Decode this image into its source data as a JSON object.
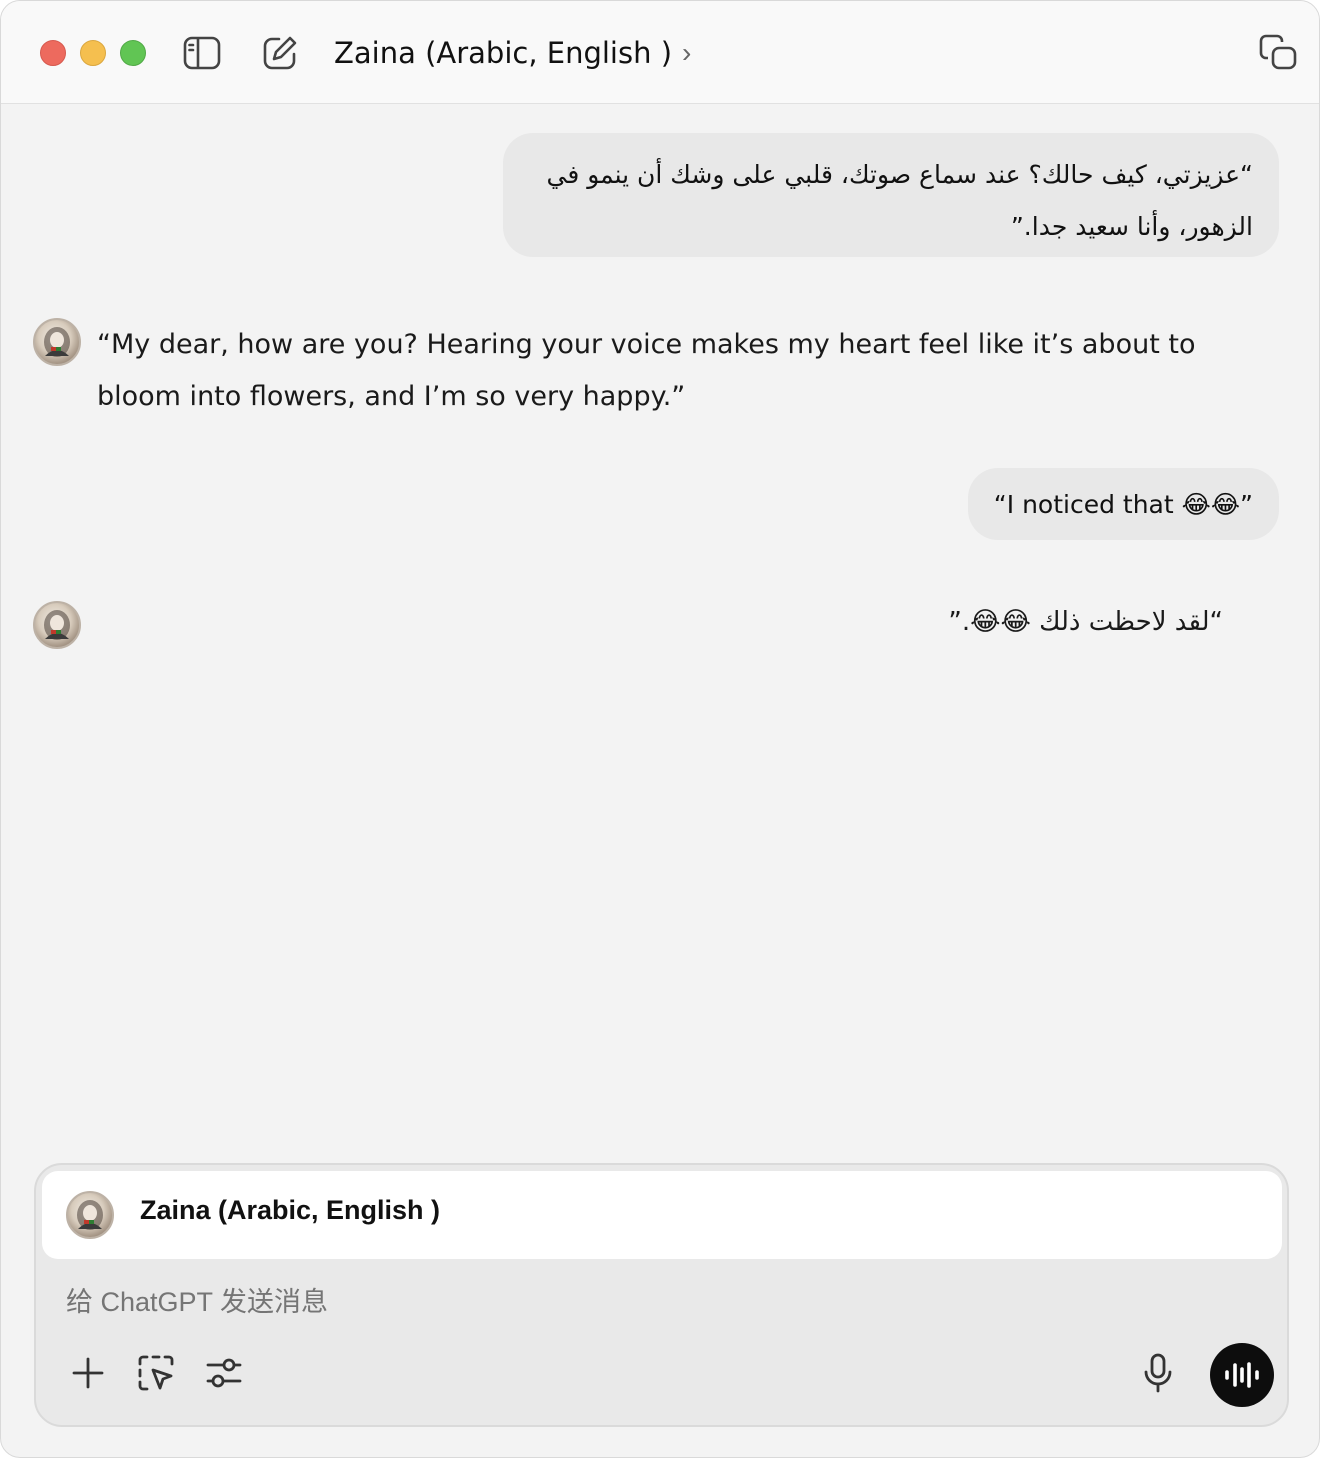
{
  "titlebar": {
    "title": "Zaina (Arabic, English )",
    "chevron": "›",
    "icons": [
      "sidebar-toggle-icon",
      "new-chat-icon",
      "window-share-icon"
    ]
  },
  "messages": {
    "user_1": "“عزيزتي، كيف حالك؟ عند سماع صوتك، قلبي على وشك أن ينمو في الزهور، وأنا سعيد جدا.”",
    "assistant_1": "“My dear, how are you? Hearing your voice makes my heart feel like it’s about to bloom into flowers, and I’m so very happy.”",
    "user_2": "“I noticed that 😂😂”",
    "assistant_2": "“لقد لاحظت ذلك 😂😂.”"
  },
  "composer": {
    "gpt_name": "Zaina (Arabic, English )",
    "placeholder": "给 ChatGPT 发送消息",
    "tools": [
      "plus-icon",
      "screen-select-icon",
      "settings-sliders-icon",
      "microphone-icon",
      "voice-mode-icon"
    ]
  },
  "colors": {
    "window_bg": "#f3f3f3",
    "bubble_bg": "#e8e8e8",
    "voice_button": "#0d0d0d",
    "close": "#ed6a5e",
    "minimize": "#f5bf4f",
    "zoom": "#61c554"
  }
}
